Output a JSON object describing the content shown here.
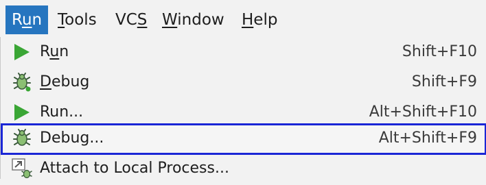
{
  "menubar": {
    "items": [
      {
        "pre": "R",
        "mn": "u",
        "post": "n"
      },
      {
        "pre": "",
        "mn": "T",
        "post": "ools"
      },
      {
        "pre": "VC",
        "mn": "S",
        "post": ""
      },
      {
        "pre": "",
        "mn": "W",
        "post": "indow"
      },
      {
        "pre": "",
        "mn": "H",
        "post": "elp"
      }
    ]
  },
  "run_menu": {
    "items": [
      {
        "pre": "R",
        "mn": "u",
        "post": "n",
        "shortcut": "Shift+F10",
        "icon": "run-icon"
      },
      {
        "pre": "",
        "mn": "D",
        "post": "ebug",
        "shortcut": "Shift+F9",
        "icon": "debug-icon"
      },
      {
        "pre": "",
        "mn": "",
        "post": "Run...",
        "shortcut": "Alt+Shift+F10",
        "icon": "run-icon"
      },
      {
        "pre": "",
        "mn": "",
        "post": "Debug...",
        "shortcut": "Alt+Shift+F9",
        "icon": "debug-icon"
      },
      {
        "pre": "",
        "mn": "",
        "post": "Attach to Local Process...",
        "shortcut": "",
        "icon": "attach-process-icon"
      }
    ]
  },
  "colors": {
    "active_menu_bg": "#2675bf",
    "focus_border": "#1a26d6",
    "run_green": "#3aa635"
  }
}
